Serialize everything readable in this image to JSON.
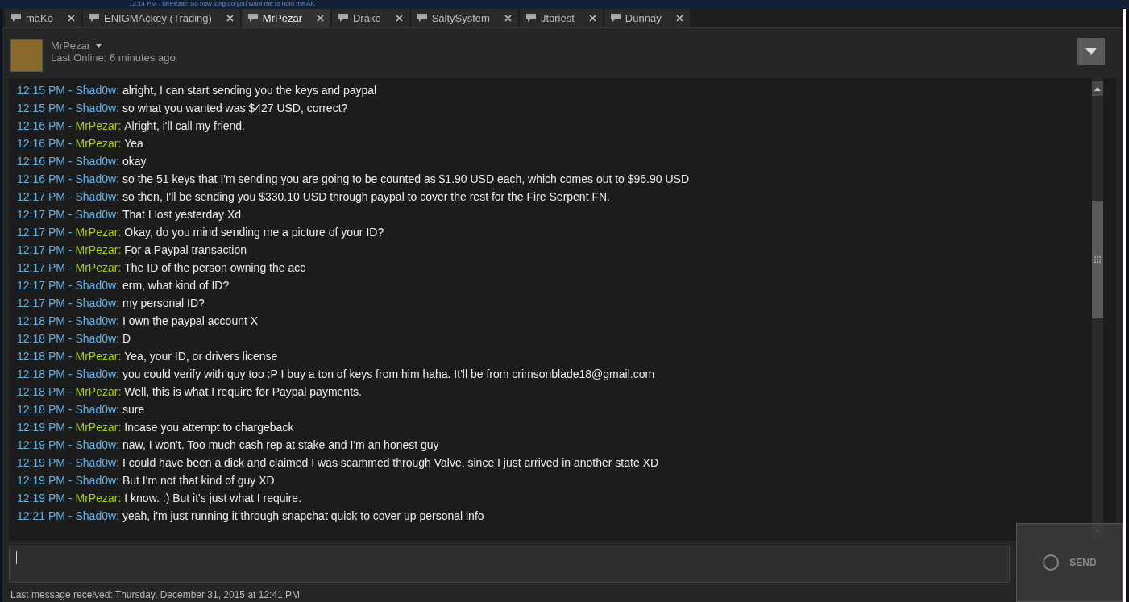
{
  "background_notification": "12:14 PM - MrPezar: So how long do you want me to hold the AK",
  "tabs": [
    {
      "label": "maKo",
      "selected": false
    },
    {
      "label": "ENIGMAckey (Trading)",
      "selected": false
    },
    {
      "label": "MrPezar",
      "selected": true
    },
    {
      "label": "Drake",
      "selected": false
    },
    {
      "label": "SaltySystem",
      "selected": false
    },
    {
      "label": "Jtpriest",
      "selected": false
    },
    {
      "label": "Dunnay",
      "selected": false
    }
  ],
  "header": {
    "name": "MrPezar",
    "status": "Last Online: 6 minutes ago"
  },
  "messages": [
    {
      "time": "12:15 PM -",
      "sender": "Shad0w:",
      "kind": "self",
      "text": "alright, I can start sending you the keys and paypal"
    },
    {
      "time": "12:15 PM -",
      "sender": "Shad0w:",
      "kind": "self",
      "text": "so what you wanted was $427 USD, correct?"
    },
    {
      "time": "12:16 PM -",
      "sender": "MrPezar:",
      "kind": "friend",
      "text": "Alright, i'll call my friend."
    },
    {
      "time": "12:16 PM -",
      "sender": "MrPezar:",
      "kind": "friend",
      "text": "Yea"
    },
    {
      "time": "12:16 PM -",
      "sender": "Shad0w:",
      "kind": "self",
      "text": "okay"
    },
    {
      "time": "12:16 PM -",
      "sender": "Shad0w:",
      "kind": "self",
      "text": "so the 51 keys that I'm sending you are going to be counted as $1.90 USD each, which comes out to $96.90 USD"
    },
    {
      "time": "12:17 PM -",
      "sender": "Shad0w:",
      "kind": "self",
      "text": "so then, I'll be sending you $330.10 USD through paypal to cover the rest for the Fire Serpent FN."
    },
    {
      "time": "12:17 PM -",
      "sender": "Shad0w:",
      "kind": "self",
      "text": "That I lost yesterday Xd"
    },
    {
      "time": "12:17 PM -",
      "sender": "MrPezar:",
      "kind": "friend",
      "text": "Okay, do you mind sending me a picture of your ID?"
    },
    {
      "time": "12:17 PM -",
      "sender": "MrPezar:",
      "kind": "friend",
      "text": "For a Paypal transaction"
    },
    {
      "time": "12:17 PM -",
      "sender": "MrPezar:",
      "kind": "friend",
      "text": "The ID of the person owning the acc"
    },
    {
      "time": "12:17 PM -",
      "sender": "Shad0w:",
      "kind": "self",
      "text": "erm, what kind of ID?"
    },
    {
      "time": "12:17 PM -",
      "sender": "Shad0w:",
      "kind": "self",
      "text": "my personal ID?"
    },
    {
      "time": "12:18 PM -",
      "sender": "Shad0w:",
      "kind": "self",
      "text": "I own the paypal account X"
    },
    {
      "time": "12:18 PM -",
      "sender": "Shad0w:",
      "kind": "self",
      "text": "D"
    },
    {
      "time": "12:18 PM -",
      "sender": "MrPezar:",
      "kind": "friend",
      "text": "Yea, your ID, or drivers license"
    },
    {
      "time": "12:18 PM -",
      "sender": "Shad0w:",
      "kind": "self",
      "text": "you could verify with quy too :P I buy a ton of keys from him haha. It'll be from crimsonblade18@gmail.com"
    },
    {
      "time": "12:18 PM -",
      "sender": "MrPezar:",
      "kind": "friend",
      "text": "Well, this is what I require for Paypal payments."
    },
    {
      "time": "12:18 PM -",
      "sender": "Shad0w:",
      "kind": "self",
      "text": "sure"
    },
    {
      "time": "12:19 PM -",
      "sender": "MrPezar:",
      "kind": "friend",
      "text": "Incase you attempt to chargeback"
    },
    {
      "time": "12:19 PM -",
      "sender": "Shad0w:",
      "kind": "self",
      "text": "naw, I won't. Too much cash rep at stake and I'm an honest guy"
    },
    {
      "time": "12:19 PM -",
      "sender": "Shad0w:",
      "kind": "self",
      "text": "I could have been a dick and claimed I was scammed through Valve, since I just arrived in another state XD"
    },
    {
      "time": "12:19 PM -",
      "sender": "Shad0w:",
      "kind": "self",
      "text": "But I'm not that kind of guy XD"
    },
    {
      "time": "12:19 PM -",
      "sender": "MrPezar:",
      "kind": "friend",
      "text": "I know. :) But it's just what I require."
    },
    {
      "time": "12:21 PM -",
      "sender": "Shad0w:",
      "kind": "self",
      "text": "yeah, i'm just running it through snapchat quick to cover up personal info"
    }
  ],
  "thumbnail": {
    "button": "SEND"
  },
  "footer": "Last message received: Thursday, December 31, 2015 at 12:41 PM"
}
